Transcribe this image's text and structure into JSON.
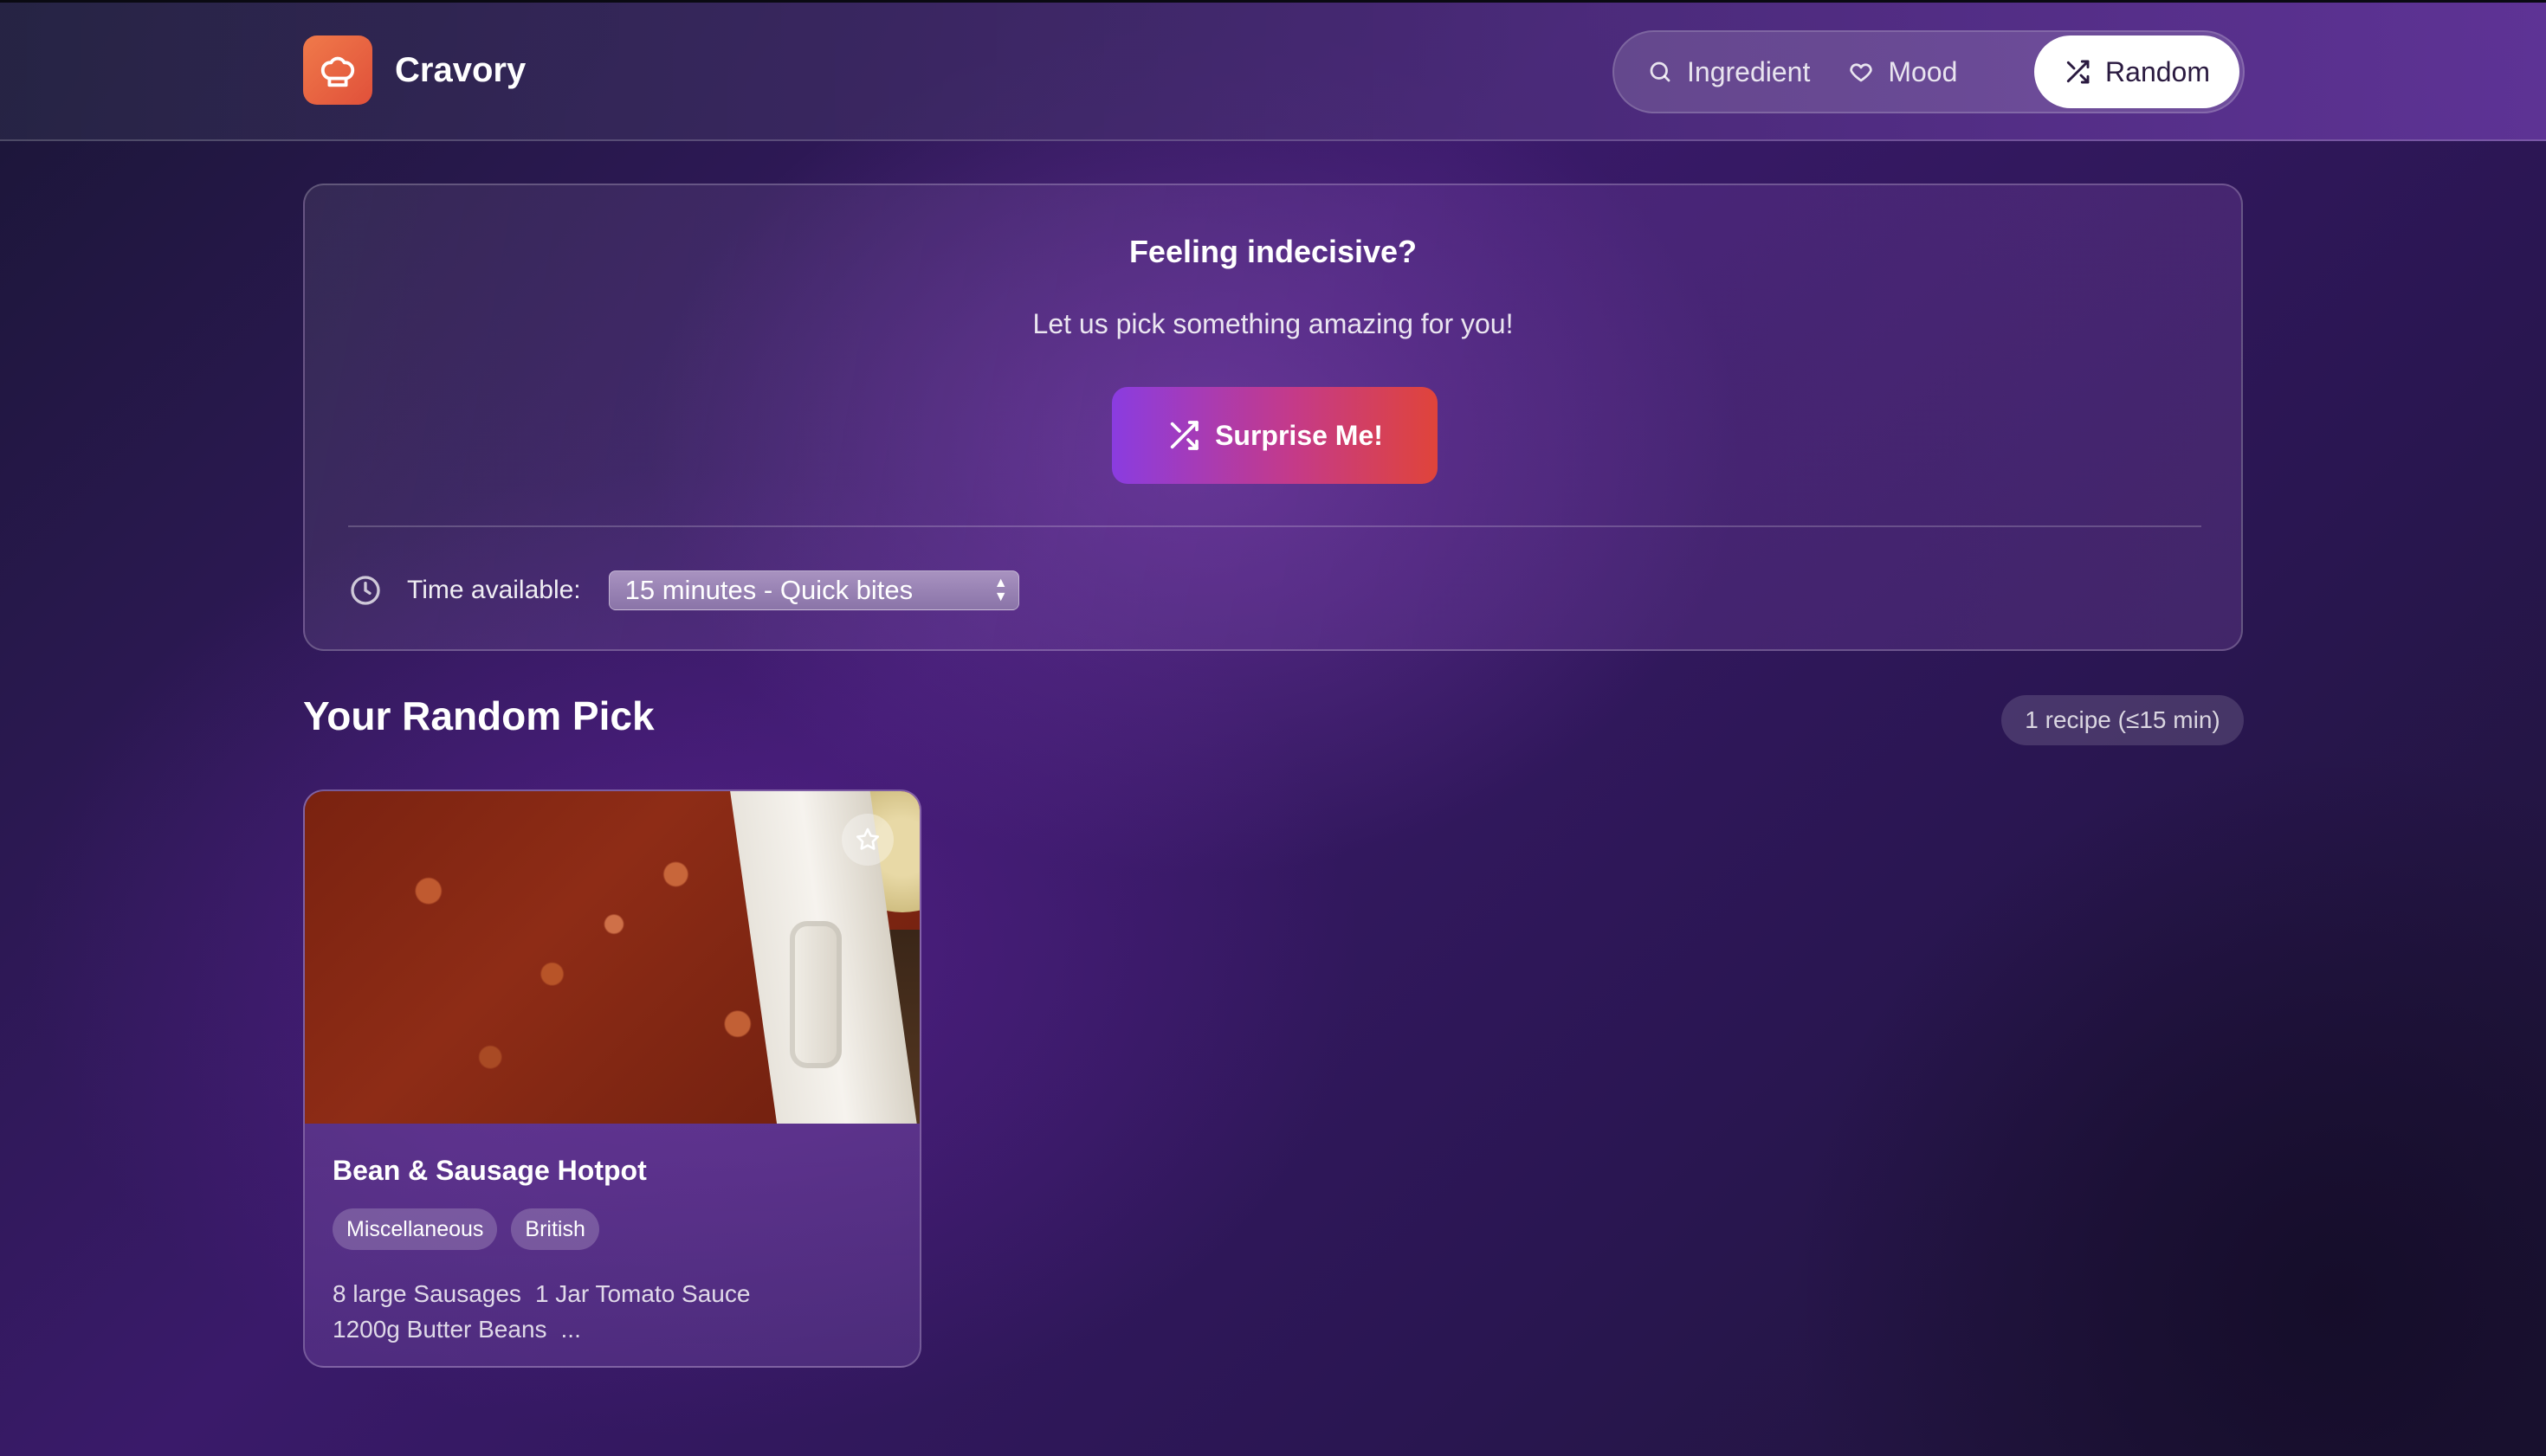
{
  "app": {
    "name": "Cravory"
  },
  "nav": {
    "ingredient": "Ingredient",
    "mood": "Mood",
    "random": "Random",
    "active": "random"
  },
  "random_card": {
    "title": "Feeling indecisive?",
    "subtitle": "Let us pick something amazing for you!",
    "button_label": "Surprise Me!",
    "time_label": "Time available:",
    "time_selected": "15 minutes - Quick bites"
  },
  "results": {
    "title": "Your Random Pick",
    "badge": "1 recipe (≤15 min)",
    "recipes": [
      {
        "name": "Bean & Sausage Hotpot",
        "tags": [
          "Miscellaneous",
          "British"
        ],
        "ingredients": [
          "8 large Sausages",
          "1 Jar Tomato Sauce",
          "1200g Butter Beans",
          "..."
        ]
      }
    ]
  },
  "icons": {
    "logo": "chef-hat-icon",
    "ingredient": "search-icon",
    "mood": "heart-icon",
    "random": "shuffle-icon",
    "time": "clock-icon",
    "favorite": "star-icon"
  },
  "colors": {
    "logo": "#e8603e",
    "button_start": "#8a3ce0",
    "button_end": "#e0443a",
    "nav_active_bg": "#ffffff"
  }
}
